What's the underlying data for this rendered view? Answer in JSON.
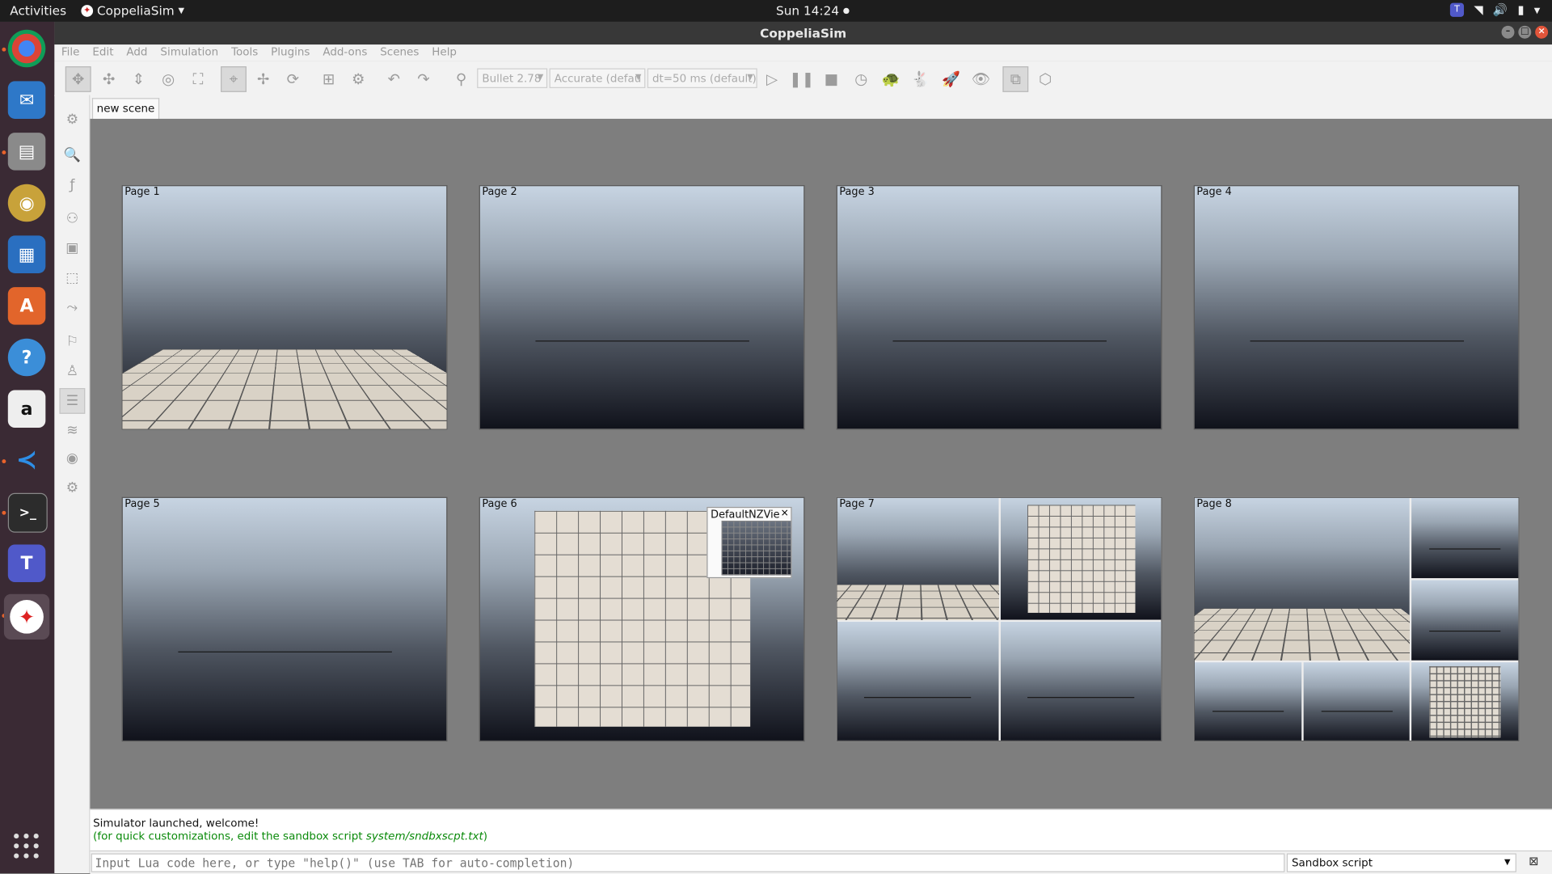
{
  "topbar": {
    "activities": "Activities",
    "app_name": "CoppeliaSim",
    "clock": "Sun 14:24"
  },
  "window": {
    "title": "CoppeliaSim"
  },
  "menu": [
    "File",
    "Edit",
    "Add",
    "Simulation",
    "Tools",
    "Plugins",
    "Add-ons",
    "Scenes",
    "Help"
  ],
  "toolbar": {
    "physics_engine": "Bullet 2.78",
    "accuracy": "Accurate (defau",
    "timestep": "dt=50 ms (default)"
  },
  "scene_tab": "new scene",
  "pages": [
    "Page 1",
    "Page 2",
    "Page 3",
    "Page 4",
    "Page 5",
    "Page 6",
    "Page 7",
    "Page 8"
  ],
  "floating_view": {
    "title": "DefaultNZVie",
    "close": "×"
  },
  "console": {
    "line1": "Simulator launched, welcome!",
    "line2_prefix": "(for quick customizations, edit the sandbox script ",
    "line2_path": "system/sndbxscpt.txt",
    "line2_suffix": ")"
  },
  "input": {
    "placeholder": "Input Lua code here, or type \"help()\" (use TAB for auto-completion)",
    "script_selector": "Sandbox script"
  },
  "colors": {
    "dock_bg": "#3a2a34",
    "topbar_bg": "#1d1d1d",
    "viewport_bg": "#7e7e7e",
    "console_green": "#0a8a0a"
  }
}
